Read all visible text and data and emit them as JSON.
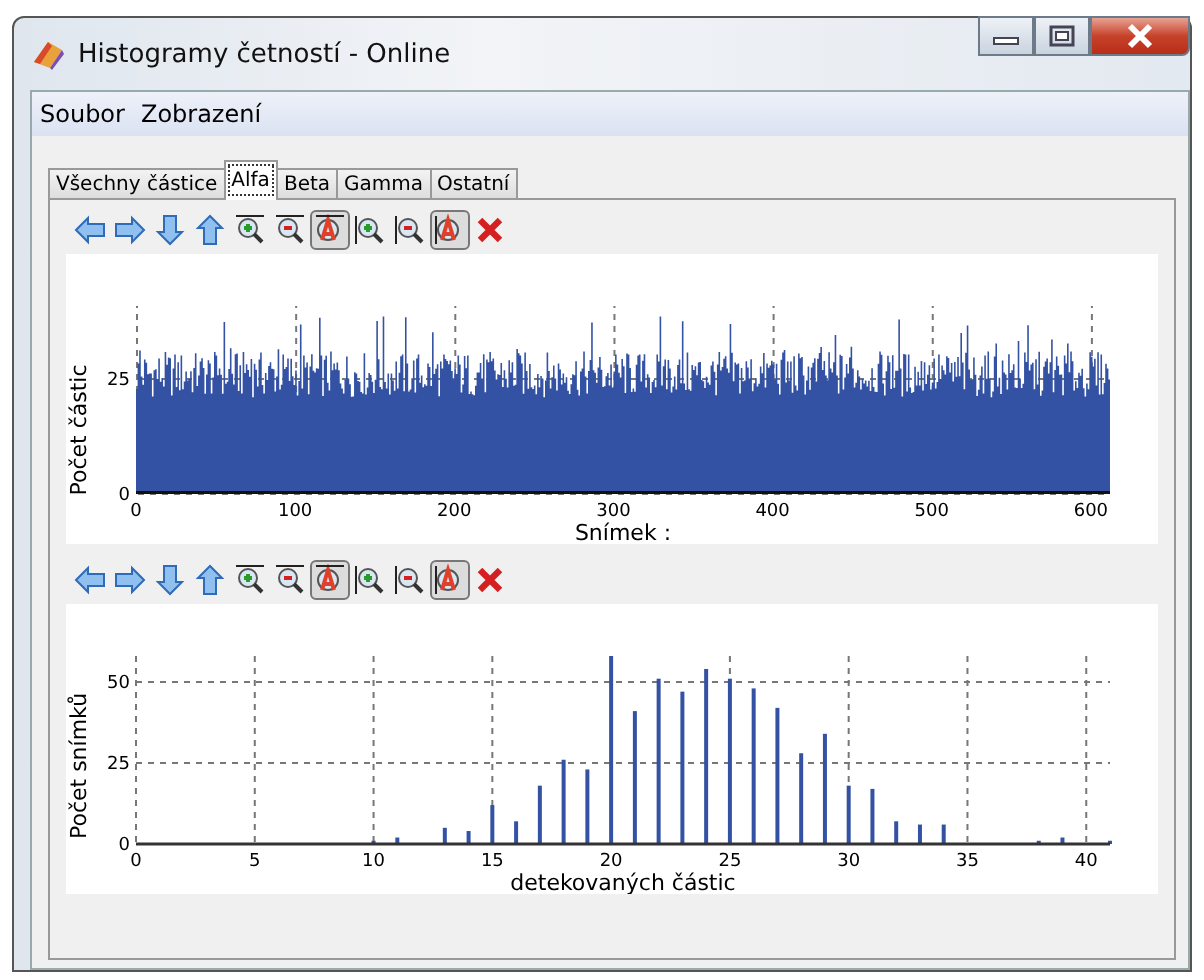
{
  "window": {
    "title": "Histogramy četností - Online"
  },
  "menu": [
    "Soubor",
    "Zobrazení"
  ],
  "tabs": [
    {
      "label": "Všechny částice",
      "selected": false
    },
    {
      "label": "Alfa",
      "selected": true
    },
    {
      "label": "Beta",
      "selected": false
    },
    {
      "label": "Gamma",
      "selected": false
    },
    {
      "label": "Ostatní",
      "selected": false
    }
  ],
  "panels": [
    {
      "toolbar": [
        {
          "kind": "left",
          "on": false
        },
        {
          "kind": "right",
          "on": false
        },
        {
          "kind": "down",
          "on": false
        },
        {
          "kind": "up",
          "on": false
        },
        {
          "kind": "zoomin-x",
          "on": false
        },
        {
          "kind": "zoomout-x",
          "on": false
        },
        {
          "kind": "auto-x",
          "on": true
        },
        {
          "kind": "zoomin-y",
          "on": false
        },
        {
          "kind": "zoomout-y",
          "on": false
        },
        {
          "kind": "auto-y",
          "on": true
        },
        {
          "kind": "delete",
          "on": false
        }
      ],
      "frame_histogram": {
        "ylabel": "Počet částic",
        "xlabel": "Snímek :",
        "xticks": [
          "0",
          "100",
          "200",
          "300",
          "400",
          "500",
          "600"
        ],
        "yticks": [
          "25",
          "0"
        ]
      }
    },
    {
      "toolbar": [
        {
          "kind": "left",
          "on": false
        },
        {
          "kind": "right",
          "on": false
        },
        {
          "kind": "down",
          "on": false
        },
        {
          "kind": "up",
          "on": false
        },
        {
          "kind": "zoomin-x",
          "on": false
        },
        {
          "kind": "zoomout-x",
          "on": false
        },
        {
          "kind": "auto-x",
          "on": true
        },
        {
          "kind": "zoomin-y",
          "on": false
        },
        {
          "kind": "zoomout-y",
          "on": false
        },
        {
          "kind": "auto-y",
          "on": true
        },
        {
          "kind": "delete",
          "on": false
        }
      ],
      "chart_data": {
        "type": "bar",
        "grid": true,
        "xlabel": "detekovaných částic",
        "ylabel": "Počet snímků",
        "xlim": [
          0,
          41
        ],
        "ylim": [
          0,
          58
        ],
        "xticks": [
          0,
          5,
          10,
          15,
          20,
          25,
          30,
          35,
          40
        ],
        "yticks": [
          0,
          25,
          50
        ],
        "x": [
          10,
          11,
          13,
          14,
          15,
          16,
          17,
          18,
          19,
          20,
          21,
          22,
          23,
          24,
          25,
          26,
          27,
          28,
          29,
          30,
          31,
          32,
          33,
          34,
          38,
          39,
          41
        ],
        "series": [
          {
            "color": "#3452a4",
            "values": [
              1,
              2,
              5,
              4,
              12,
              7,
              18,
              26,
              23,
              58,
              41,
              51,
              47,
              54,
              51,
              48,
              42,
              28,
              34,
              18,
              17,
              7,
              6,
              6,
              1,
              2,
              1
            ]
          }
        ]
      }
    }
  ]
}
